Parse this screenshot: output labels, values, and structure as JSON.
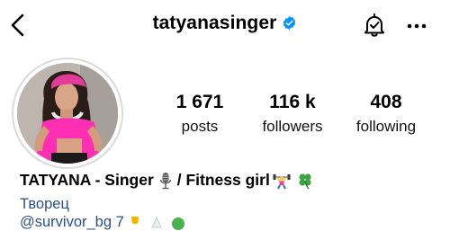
{
  "header": {
    "username": "tatyanasinger",
    "icons": {
      "back": "chevron-left-icon",
      "verified": "verified-badge-icon",
      "notifications": "bell-check-icon",
      "more": "more-horizontal-icon"
    }
  },
  "profile": {
    "avatar": "profile-photo",
    "stats": {
      "posts": {
        "value": "1 671",
        "label": "posts"
      },
      "followers": {
        "value": "116 k",
        "label": "followers"
      },
      "following": {
        "value": "408",
        "label": "following"
      }
    }
  },
  "bio": {
    "name_part1": "TATYANA - Singer",
    "name_part2": "/ Fitness girl",
    "category": "Творец",
    "mention_partial": "@survivor_bg 7"
  },
  "colors": {
    "verified_blue": "#0095f6",
    "link_blue": "#2b4f87",
    "ring_gray": "#dbdbdb"
  }
}
